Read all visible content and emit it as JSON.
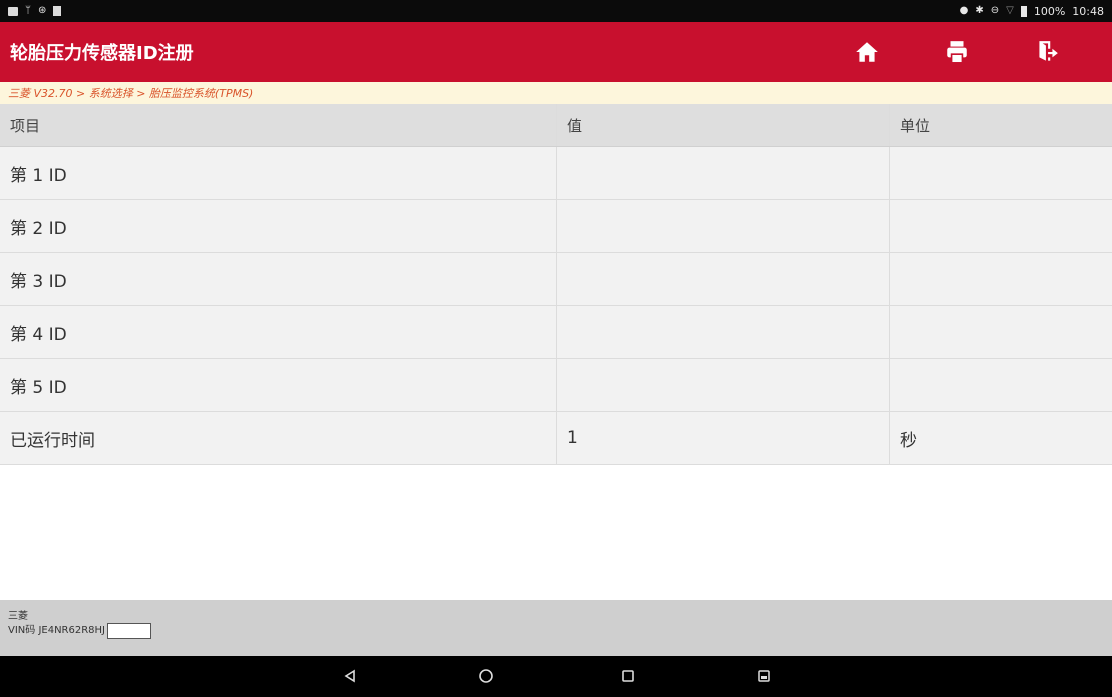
{
  "status_bar": {
    "left_icons": [
      "image-icon",
      "usb-icon",
      "sync-icon",
      "sdcard-icon"
    ],
    "right_icons": [
      "location-icon",
      "bluetooth-icon",
      "dnd-icon",
      "wifi-icon",
      "battery-icon"
    ],
    "battery": "100%",
    "time": "10:48"
  },
  "header": {
    "title": "轮胎压力传感器ID注册",
    "color": "#c8102e",
    "buttons": [
      "home-icon",
      "print-icon",
      "exit-icon"
    ]
  },
  "breadcrumb": "三菱 V32.70 > 系统选择 > 胎压监控系统(TPMS)",
  "table": {
    "columns": [
      "项目",
      "值",
      "单位"
    ],
    "rows": [
      {
        "item": "第 1 ID",
        "value": "",
        "unit": ""
      },
      {
        "item": "第 2 ID",
        "value": "",
        "unit": ""
      },
      {
        "item": "第 3 ID",
        "value": "",
        "unit": ""
      },
      {
        "item": "第 4 ID",
        "value": "",
        "unit": ""
      },
      {
        "item": "第 5 ID",
        "value": "",
        "unit": ""
      },
      {
        "item": "已运行时间",
        "value": "1",
        "unit": "秒"
      }
    ]
  },
  "footer": {
    "make": "三菱",
    "vin": "VIN码 JE4NR62R8HJ"
  },
  "navbar": [
    "back-icon",
    "home-circle-icon",
    "recents-icon",
    "screenshot-icon"
  ]
}
